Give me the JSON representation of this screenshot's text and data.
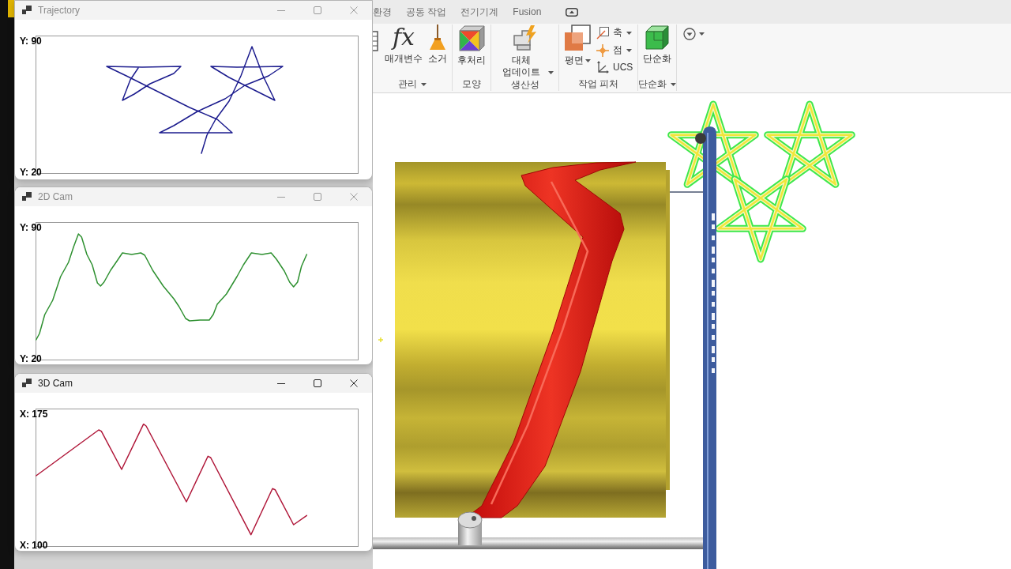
{
  "windows": [
    {
      "title": "Trajectory",
      "active": false,
      "plot": {
        "kind": "trajectory",
        "color": "#1c1c8e",
        "top_label": "Y: 90",
        "bottom_label": "Y: 20"
      }
    },
    {
      "title": "2D Cam",
      "active": false,
      "plot": {
        "kind": "profile",
        "color": "#2e9030",
        "top_label": "Y: 90",
        "bottom_label": "Y: 20"
      }
    },
    {
      "title": "3D Cam",
      "active": true,
      "plot": {
        "kind": "zigzag",
        "color": "#b0183a",
        "top_label": "X: 175",
        "bottom_label": "X: 100"
      }
    }
  ],
  "app": {
    "tabs": [
      {
        "label": "환경",
        "selected": false
      },
      {
        "label": "공동 작업",
        "selected": false
      },
      {
        "label": "전기기계",
        "selected": false
      },
      {
        "label": "Fusion",
        "selected": false
      }
    ],
    "ribbon": {
      "groups": [
        {
          "label": "관리",
          "menu": true,
          "tools": [
            {
              "glyph": "fx",
              "label": "매개변수",
              "dropdown": false
            },
            {
              "label": "소거",
              "dropdown": false
            }
          ]
        },
        {
          "label": "모양",
          "menu": false,
          "tools": [
            {
              "label": "후처리",
              "dropdown": false
            }
          ]
        },
        {
          "label": "생산성",
          "menu": false,
          "tools": [
            {
              "label": "대체 업데이트",
              "dropdown": true
            }
          ]
        },
        {
          "label": "작업 피처",
          "menu": false,
          "tools": [
            {
              "label": "평면",
              "dropdown": true
            }
          ],
          "small_tools": [
            {
              "label": "축",
              "dropdown": true
            },
            {
              "label": "점",
              "dropdown": true
            },
            {
              "label": "UCS",
              "dropdown": false
            }
          ]
        },
        {
          "label": "단순화",
          "menu": true,
          "tools": [
            {
              "label": "단순화",
              "dropdown": false
            }
          ]
        }
      ],
      "options_menu": {
        "dropdown": true
      }
    }
  }
}
